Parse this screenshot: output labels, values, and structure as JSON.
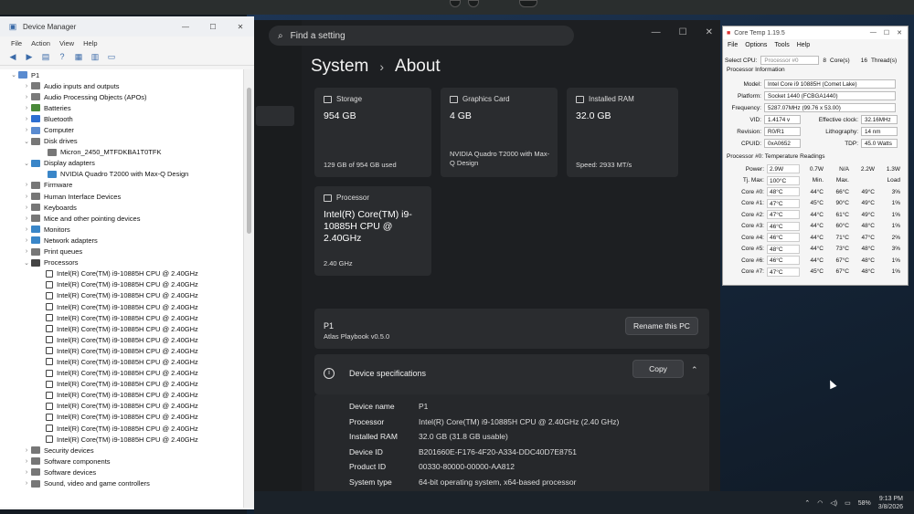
{
  "device_manager": {
    "title": "Device Manager",
    "menu": [
      "File",
      "Action",
      "View",
      "Help"
    ],
    "tree": [
      {
        "level": 0,
        "exp": "⌄",
        "label": "P1",
        "color": "#5a8bd0"
      },
      {
        "level": 1,
        "exp": "›",
        "label": "Audio inputs and outputs",
        "color": "#7a7a7a"
      },
      {
        "level": 1,
        "exp": "›",
        "label": "Audio Processing Objects (APOs)",
        "color": "#7a7a7a"
      },
      {
        "level": 1,
        "exp": "›",
        "label": "Batteries",
        "color": "#4a8a3a"
      },
      {
        "level": 1,
        "exp": "›",
        "label": "Bluetooth",
        "color": "#2d6fd1"
      },
      {
        "level": 1,
        "exp": "›",
        "label": "Computer",
        "color": "#5a8bd0"
      },
      {
        "level": 1,
        "exp": "⌄",
        "label": "Disk drives",
        "color": "#777"
      },
      {
        "level": 2,
        "exp": "",
        "label": "Micron_2450_MTFDKBA1T0TFK",
        "color": "#777"
      },
      {
        "level": 1,
        "exp": "⌄",
        "label": "Display adapters",
        "color": "#3a86c8"
      },
      {
        "level": 2,
        "exp": "",
        "label": "NVIDIA Quadro T2000 with Max-Q Design",
        "color": "#3a86c8"
      },
      {
        "level": 1,
        "exp": "›",
        "label": "Firmware",
        "color": "#777"
      },
      {
        "level": 1,
        "exp": "›",
        "label": "Human Interface Devices",
        "color": "#777"
      },
      {
        "level": 1,
        "exp": "›",
        "label": "Keyboards",
        "color": "#777"
      },
      {
        "level": 1,
        "exp": "›",
        "label": "Mice and other pointing devices",
        "color": "#777"
      },
      {
        "level": 1,
        "exp": "›",
        "label": "Monitors",
        "color": "#3a86c8"
      },
      {
        "level": 1,
        "exp": "›",
        "label": "Network adapters",
        "color": "#3a86c8"
      },
      {
        "level": 1,
        "exp": "›",
        "label": "Print queues",
        "color": "#777"
      },
      {
        "level": 1,
        "exp": "⌄",
        "label": "Processors",
        "color": "#444"
      }
    ],
    "processor_label": "Intel(R) Core(TM) i9-10885H CPU @ 2.40GHz",
    "processor_count": 16,
    "tail": [
      {
        "level": 1,
        "exp": "›",
        "label": "Security devices",
        "color": "#777"
      },
      {
        "level": 1,
        "exp": "›",
        "label": "Software components",
        "color": "#777"
      },
      {
        "level": 1,
        "exp": "›",
        "label": "Software devices",
        "color": "#777"
      },
      {
        "level": 1,
        "exp": "›",
        "label": "Sound, video and game controllers",
        "color": "#777"
      }
    ]
  },
  "settings": {
    "search_placeholder": "Find a setting",
    "crumb_parent": "System",
    "crumb_current": "About",
    "storage": {
      "title": "Storage",
      "value": "954 GB",
      "detail": "129 GB of 954 GB used"
    },
    "graphics": {
      "title": "Graphics Card",
      "value": "4 GB",
      "detail": "NVIDIA Quadro T2000 with Max-Q Design"
    },
    "ram": {
      "title": "Installed RAM",
      "value": "32.0 GB",
      "detail": "Speed: 2933 MT/s"
    },
    "processor": {
      "title": "Processor",
      "value": "Intel(R) Core(TM) i9-10885H CPU @ 2.40GHz",
      "detail": "2.40 GHz"
    },
    "pc_name": "P1",
    "pc_sub": "Atlas Playbook v0.5.0",
    "rename_label": "Rename this PC",
    "specs_title": "Device specifications",
    "copy_label": "Copy",
    "specs": [
      {
        "k": "Device name",
        "v": "P1"
      },
      {
        "k": "Processor",
        "v": "Intel(R) Core(TM) i9-10885H CPU @ 2.40GHz (2.40 GHz)"
      },
      {
        "k": "Installed RAM",
        "v": "32.0 GB (31.8 GB usable)"
      },
      {
        "k": "Device ID",
        "v": "B201660E-F176-4F20-A334-DDC40D7E8751"
      },
      {
        "k": "Product ID",
        "v": "00330-80000-00000-AA812"
      },
      {
        "k": "System type",
        "v": "64-bit operating system, x64-based processor"
      },
      {
        "k": "Pen and touch",
        "v": "No pen or touch input is available for this display"
      }
    ]
  },
  "coretemp": {
    "title": "Core Temp 1.19.5",
    "menu": [
      "File",
      "Options",
      "Tools",
      "Help"
    ],
    "select_cpu_label": "Select CPU:",
    "select_cpu_value": "Processor #0",
    "cores_num": "8",
    "cores_label": "Core(s)",
    "threads_num": "16",
    "threads_label": "Thread(s)",
    "info_header": "Processor Information",
    "model_label": "Model:",
    "model": "Intel Core i9 10885H (Comet Lake)",
    "platform_label": "Platform:",
    "platform": "Socket 1440 (FCBGA1440)",
    "frequency_label": "Frequency:",
    "frequency": "5287.07MHz (99.76 x 53.00)",
    "vid_label": "VID:",
    "vid": "1.4174 v",
    "effclock_label": "Effective clock:",
    "effclock": "32.16MHz",
    "revision_label": "Revision:",
    "revision": "R0/R1",
    "litho_label": "Lithography:",
    "litho": "14 nm",
    "cpuid_label": "CPUID:",
    "cpuid": "0xA0652",
    "tdp_label": "TDP:",
    "tdp": "45.0 Watts",
    "temp_header": "Processor #0: Temperature Readings",
    "power_label": "Power:",
    "power": [
      "2.9W",
      "0.7W",
      "N/A",
      "2.2W",
      "1.3W"
    ],
    "tjmax_label": "Tj. Max:",
    "tjmax": "100°C",
    "col_headers": [
      "Min.",
      "Max.",
      "Load"
    ],
    "cores": [
      {
        "name": "Core #0:",
        "cur": "48°C",
        "min": "44°C",
        "max": "66°C",
        "load": "3%"
      },
      {
        "name": "Core #1:",
        "cur": "47°C",
        "min": "45°C",
        "max": "90°C",
        "load": "1%"
      },
      {
        "name": "Core #2:",
        "cur": "47°C",
        "min": "44°C",
        "max": "61°C",
        "load": "1%"
      },
      {
        "name": "Core #3:",
        "cur": "46°C",
        "min": "44°C",
        "max": "60°C",
        "load": "1%"
      },
      {
        "name": "Core #4:",
        "cur": "46°C",
        "min": "44°C",
        "max": "71°C",
        "load": "2%"
      },
      {
        "name": "Core #5:",
        "cur": "48°C",
        "min": "44°C",
        "max": "73°C",
        "load": "3%"
      },
      {
        "name": "Core #6:",
        "cur": "46°C",
        "min": "44°C",
        "max": "67°C",
        "load": "1%"
      },
      {
        "name": "Core #7:",
        "cur": "47°C",
        "min": "45°C",
        "max": "67°C",
        "load": "1%"
      }
    ],
    "core_max_extra": [
      "49°C",
      "49°C",
      "49°C",
      "48°C",
      "47°C",
      "48°C",
      "48°C",
      "48°C"
    ]
  },
  "taskbar": {
    "battery": "58%",
    "time": "9:13 PM",
    "date": "3/8/2026"
  }
}
